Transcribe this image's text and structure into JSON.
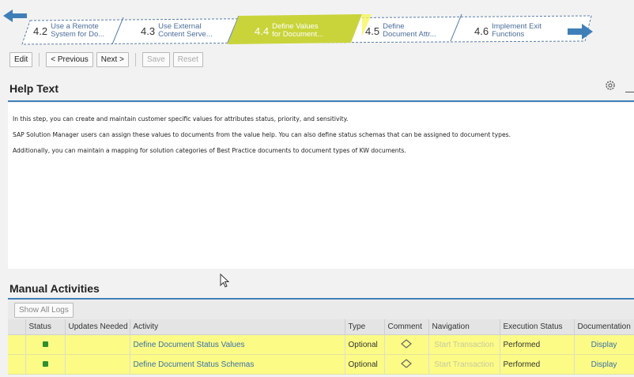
{
  "roadmap": {
    "steps": [
      {
        "num": "4.2",
        "line1": "Use a Remote",
        "line2": "System for Do...",
        "active": false
      },
      {
        "num": "4.3",
        "line1": "Use External",
        "line2": "Content Serve...",
        "active": false
      },
      {
        "num": "4.4",
        "line1": "Define Values",
        "line2": "for Document...",
        "active": true
      },
      {
        "num": "4.5",
        "line1": "Define",
        "line2": "Document Attr...",
        "active": false
      },
      {
        "num": "4.6",
        "line1": "Implement Exit",
        "line2": "Functions",
        "active": false
      }
    ],
    "active_color": "#c9d43a",
    "arrow_color": "#3f7fb8"
  },
  "toolbar": {
    "edit": "Edit",
    "previous": "< Previous",
    "next": "Next >",
    "save": "Save",
    "reset": "Reset"
  },
  "help": {
    "title": "Help Text",
    "lines": [
      "In this step, you can create and maintain customer specific values for attributes status, priority, and sensitivity.",
      "SAP Solution Manager users can assign these values to documents from the value help. You can also define status schemas that can be assigned to document types.",
      "Additionally, you can maintain a mapping for solution categories of Best Practice documents to document types of KW documents."
    ]
  },
  "manual": {
    "title": "Manual Activities",
    "show_logs": "Show All Logs",
    "columns": [
      "Status",
      "Updates Needed",
      "Activity",
      "Type",
      "Comment",
      "Navigation",
      "Execution Status",
      "Documentation"
    ],
    "rows": [
      {
        "activity": "Define Document Status Values",
        "type": "Optional",
        "navigation": "Start Transaction",
        "execution": "Performed",
        "documentation": "Display"
      },
      {
        "activity": "Define Document Status Schemas",
        "type": "Optional",
        "navigation": "Start Transaction",
        "execution": "Performed",
        "documentation": "Display"
      }
    ],
    "highlight_color": "#fbfb86"
  }
}
